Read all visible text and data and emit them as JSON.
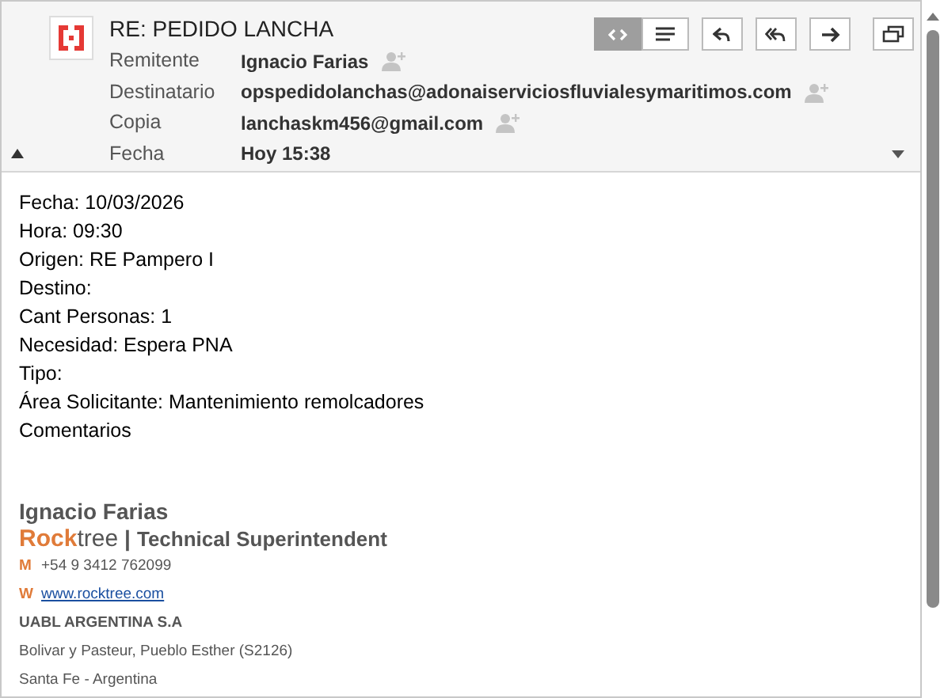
{
  "header": {
    "subject": "RE: PEDIDO LANCHA",
    "view_modes": [
      {
        "kind": "source",
        "selected": true
      },
      {
        "kind": "text",
        "selected": false
      }
    ],
    "actions": [
      {
        "kind": "reply"
      },
      {
        "kind": "reply_all"
      },
      {
        "kind": "forward"
      },
      {
        "kind": "popout"
      }
    ],
    "fields": [
      {
        "label": "Remitente",
        "value": "Ignacio Farias",
        "add_contact": true
      },
      {
        "label": "Destinatario",
        "value": "opspedidolanchas@adonaiserviciosfluvialesymaritimos.com",
        "add_contact": true
      },
      {
        "label": "Copia",
        "value": "lanchaskm456@gmail.com",
        "add_contact": true
      },
      {
        "label": "Fecha",
        "value": "Hoy 15:38",
        "add_contact": false
      }
    ]
  },
  "body": {
    "lines": [
      "Fecha: 10/03/2026",
      "Hora: 09:30",
      "Origen: RE Pampero I",
      "Destino:",
      "Cant Personas: 1",
      "Necesidad: Espera PNA",
      "Tipo:",
      "Área Solicitante: Mantenimiento remolcadores",
      "Comentarios"
    ],
    "signature": {
      "name": "Ignacio Farias",
      "brand_bold": "Rock",
      "brand_rest": "tree",
      "separator": "|",
      "role": "Technical Superintendent",
      "contacts": [
        {
          "key": "M",
          "value": "+54 9 3412 762099",
          "kind": "phone"
        },
        {
          "key": "W",
          "value": "www.rocktree.com",
          "kind": "link"
        }
      ],
      "company": "UABL ARGENTINA S.A",
      "address": [
        "Bolivar y Pasteur, Pueblo Esther (S2126)",
        "Santa Fe - Argentina"
      ]
    }
  }
}
